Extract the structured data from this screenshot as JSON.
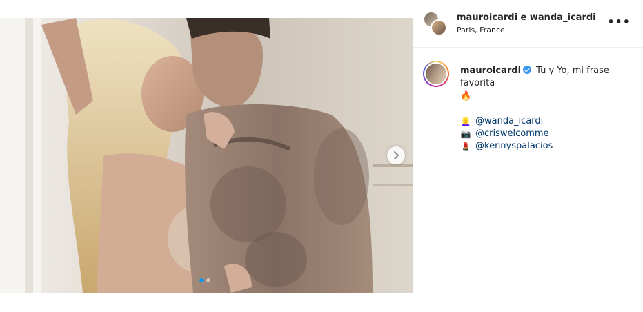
{
  "header": {
    "users": "mauroicardi e wanda_icardi",
    "location": "Paris, France",
    "more_icon": "more-options-icon",
    "more_label": "•••"
  },
  "media": {
    "carousel_dots": 2,
    "active_dot": 0,
    "next_icon": "chevron-right-icon"
  },
  "caption": {
    "username": "mauroicardi",
    "verified": true,
    "text": "Tu y Yo, mi frase favorita",
    "emoji": "🔥",
    "credits": [
      {
        "icon": "woman-emoji-icon",
        "emoji": "👱‍♀️",
        "handle": "@wanda_icardi"
      },
      {
        "icon": "camera-emoji-icon",
        "emoji": "📷",
        "handle": "@criswelcomme"
      },
      {
        "icon": "lipstick-emoji-icon",
        "emoji": "💄",
        "handle": "@kennyspalacios"
      }
    ]
  },
  "colors": {
    "link": "#00376b",
    "verified": "#3897f0",
    "dot_active": "#0095f6"
  }
}
